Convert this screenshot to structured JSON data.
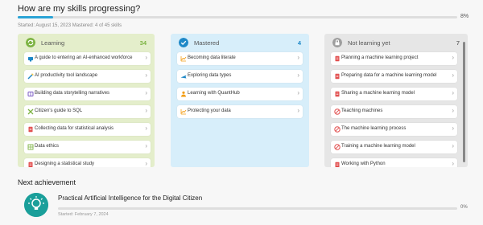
{
  "header": {
    "title": "How are my skills progressing?",
    "progress_pct": 8,
    "progress_text": "8%",
    "meta": "Started: August 15, 2023 Mastered: 4 of 45 skills"
  },
  "columns": {
    "learning": {
      "label": "Learning",
      "count": "34",
      "color": "#7cb342",
      "items": [
        {
          "label": "A guide to entering an AI-enhanced workforce",
          "icon": "certificate-icon"
        },
        {
          "label": "AI productivity tool landscape",
          "icon": "wand-icon"
        },
        {
          "label": "Building data storytelling narratives",
          "icon": "book-icon"
        },
        {
          "label": "Citizen's guide to SQL",
          "icon": "tools-icon"
        },
        {
          "label": "Collecting data for statistical analysis",
          "icon": "document-icon"
        },
        {
          "label": "Data ethics",
          "icon": "grid-icon"
        },
        {
          "label": "Designing a statistical study",
          "icon": "document-icon"
        }
      ]
    },
    "mastered": {
      "label": "Mastered",
      "count": "4",
      "color": "#1e88c7",
      "items": [
        {
          "label": "Becoming data literate",
          "icon": "chart-icon"
        },
        {
          "label": "Exploring data types",
          "icon": "airplane-icon"
        },
        {
          "label": "Learning with QuantHub",
          "icon": "person-icon"
        },
        {
          "label": "Protecting your data",
          "icon": "chart-icon"
        }
      ]
    },
    "not_learning": {
      "label": "Not learning yet",
      "count": "7",
      "color": "#888888",
      "items": [
        {
          "label": "Planning a machine learning project",
          "icon": "document-icon"
        },
        {
          "label": "Preparing data for a machine learning model",
          "icon": "document-icon"
        },
        {
          "label": "Sharing a machine learning model",
          "icon": "document-icon"
        },
        {
          "label": "Teaching machines",
          "icon": "block-icon"
        },
        {
          "label": "The machine learning process",
          "icon": "block-icon"
        },
        {
          "label": "Training a machine learning model",
          "icon": "block-icon"
        },
        {
          "label": "Working with Python",
          "icon": "document-icon"
        }
      ]
    }
  },
  "next": {
    "title": "Next achievement",
    "name": "Practical Artificial Intelligence for the Digital Citizen",
    "progress_pct": 0,
    "progress_text": "0%",
    "started": "Started: February 7, 2024",
    "icon": "lightbulb-icon"
  }
}
